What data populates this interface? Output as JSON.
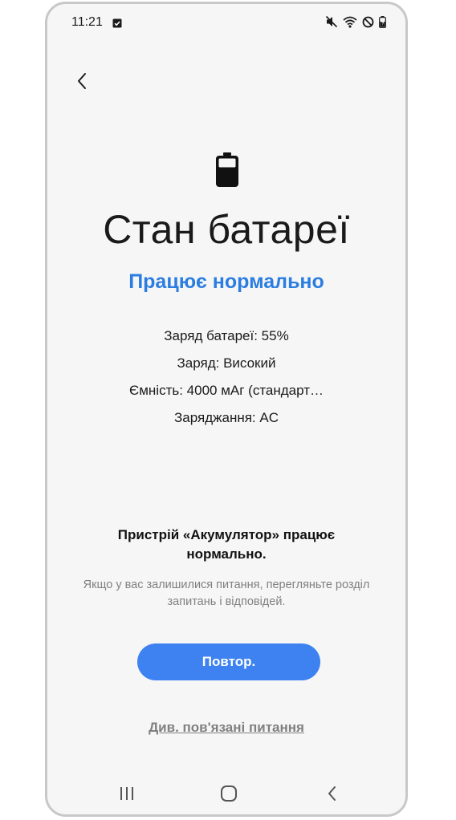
{
  "statusbar": {
    "time": "11:21",
    "icons": [
      "notification-check-icon",
      "mute-icon",
      "wifi-icon",
      "do-not-disturb-icon",
      "battery-charging-icon"
    ]
  },
  "header": {
    "back_icon": "chevron-left-icon"
  },
  "main": {
    "icon": "battery-icon",
    "title": "Стан батареї",
    "status": "Працює нормально",
    "status_color": "#2a7de1",
    "info": [
      "Заряд батареї: 55%",
      "Заряд: Високий",
      "Ємність:  4000 мАг (стандарт…",
      "Заряджання: AC"
    ],
    "message": "Пристрій «Акумулятор» працює нормально.",
    "hint": "Якщо у вас залишилися питання, перегляньте розділ запитань і відповідей.",
    "retry_label": "Повтор.",
    "retry_color": "#3d82f0",
    "related_link": "Див. пов'язані питання"
  },
  "navbar": {
    "icons": [
      "recent-apps-icon",
      "home-icon",
      "back-icon"
    ]
  }
}
